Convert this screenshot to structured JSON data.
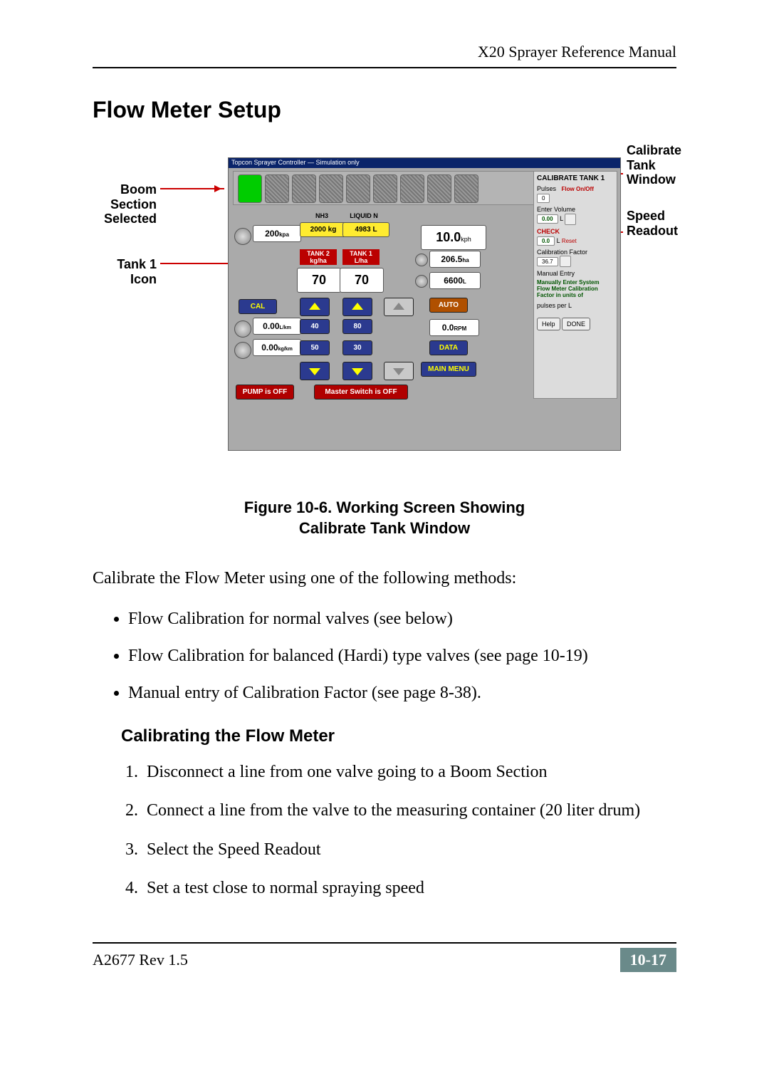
{
  "header": {
    "manual_title": "X20 Sprayer Reference Manual"
  },
  "section_heading": "Flow Meter Setup",
  "callouts": {
    "boom": "Boom\nSection\nSelected",
    "tank": "Tank 1\nIcon",
    "cal_window": "Calibrate\nTank\nWindow",
    "speed": "Speed\nReadout"
  },
  "shot": {
    "titlebar": "Topcon Sprayer Controller — Simulation only",
    "nh3_label": "NH3",
    "liquid_label": "LIQUID N",
    "pressure": "200",
    "pressure_unit": "kpa",
    "nh3_kg": "2000 kg",
    "liquid_l": "4983 L",
    "tank2_lbl": "TANK 2\nkg/ha",
    "tank1_lbl": "TANK 1\nL/ha",
    "rate_t2": "70",
    "rate_t1": "70",
    "cal": "CAL",
    "lkm_val": "0.00",
    "lkm_unit": "L/km",
    "step_a": "40",
    "step_b": "80",
    "kgkm_val": "0.00",
    "kgkm_unit": "kg/km",
    "step_c": "50",
    "step_d": "30",
    "speed": "10.0",
    "speed_unit": "kph",
    "area": "206.5",
    "area_unit": "ha",
    "vol": "6600",
    "vol_unit": "L",
    "auto": "AUTO",
    "rpm_val": "0.0",
    "rpm_unit": "RPM",
    "data": "DATA",
    "main_menu": "MAIN MENU",
    "pump_off": "PUMP is OFF",
    "master_off": "Master Switch is OFF",
    "cal_panel": {
      "title": "CALIBRATE TANK 1",
      "pulses_lbl": "Pulses",
      "pulses_val": "0",
      "flow_onoff": "Flow On/Off",
      "enter_vol_lbl": "Enter Volume",
      "enter_vol_val": "0.00",
      "enter_vol_unit": "L",
      "check_lbl": "CHECK",
      "check_val": "0.0",
      "check_unit": "L",
      "reset": "Reset",
      "factor_lbl": "Calibration Factor",
      "factor_val": "36.7",
      "manual_lbl": "Manual Entry",
      "note": "Manually Enter System\nFlow Meter Calibration\nFactor in units of",
      "note2": "pulses per L",
      "help": "Help",
      "done": "DONE"
    }
  },
  "figure_caption_l1": "Figure 10-6. Working Screen Showing",
  "figure_caption_l2": "Calibrate Tank Window",
  "intro_para": "Calibrate the Flow Meter using one of the following methods:",
  "bullets": [
    "Flow Calibration for normal valves (see below)",
    "Flow Calibration for balanced (Hardi) type valves (see page 10-19)",
    "Manual entry of Calibration Factor (see page 8-38)."
  ],
  "subsection_heading": "Calibrating the Flow Meter",
  "steps": [
    "Disconnect a line from one valve going to a Boom Section",
    "Connect a line from the valve to the measuring container (20 liter drum)",
    "Select the Speed Readout",
    "Set a test close to normal spraying speed"
  ],
  "footer": {
    "doc_rev": "A2677 Rev 1.5",
    "page_num": "10-17"
  }
}
